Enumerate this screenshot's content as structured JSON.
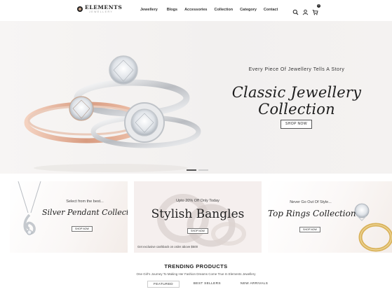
{
  "header": {
    "brand": "ELEMENTS",
    "brand_sub": "JEWELLERY",
    "nav": [
      "Jewellery",
      "Blogs",
      "Accessories",
      "Collection",
      "Category",
      "Contact"
    ],
    "icons": [
      "search-icon",
      "user-icon",
      "cart-icon"
    ],
    "cart_count": "0"
  },
  "hero": {
    "tagline": "Every Piece Of Jewellery Tells A Story",
    "title": "Classic Jewellery Collection",
    "button": "SHOP NOW",
    "slides": 2,
    "active_slide": 1
  },
  "banners": [
    {
      "kicker": "Select from the best...",
      "title": "Silver Pendant Collection",
      "button": "SHOP NOW"
    },
    {
      "kicker": "Upto 20% Off Only Today",
      "title": "Stylish Bangles",
      "button": "SHOP NOW",
      "note": "Get exclusive cashback on order above $500"
    },
    {
      "kicker": "Never Go Out Of Style...",
      "title": "Top Rings Collection",
      "button": "SHOP NOW"
    }
  ],
  "trending": {
    "title": "TRENDING PRODUCTS",
    "subtitle": "One Girl's Journey To Making Her Fashion Dreams Come True In Elements Jewellery",
    "tabs": [
      "FEATURED",
      "BEST SELLERS",
      "NEW ARRIVALS"
    ],
    "active_tab": "FEATURED"
  },
  "colors": {
    "accent": "#222222",
    "rose_gold": "#e0b59c",
    "gold": "#d9b25a",
    "hero_bg": "#f3f1f0"
  }
}
